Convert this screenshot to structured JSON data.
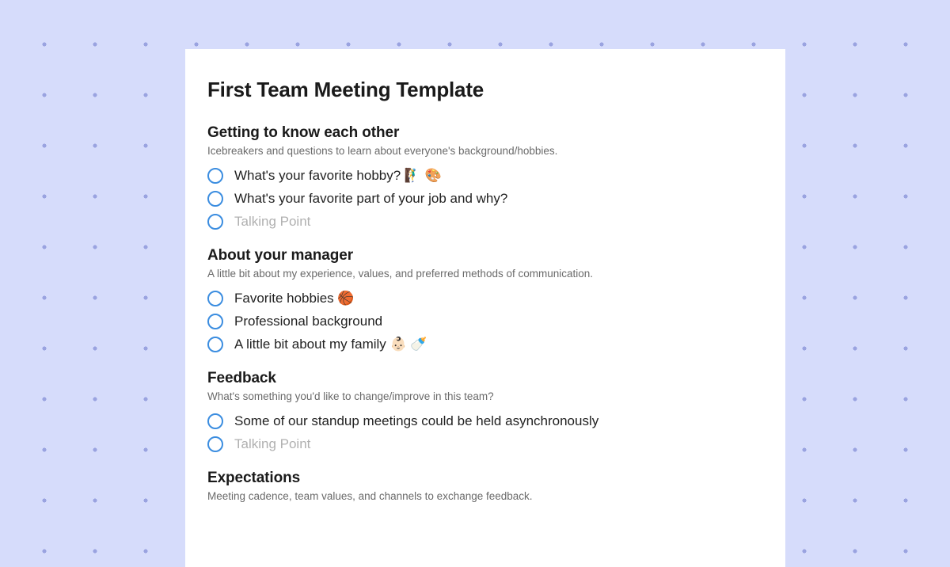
{
  "title": "First Team Meeting Template",
  "sections": [
    {
      "heading": "Getting to know each other",
      "subtitle": "Icebreakers and questions to learn about everyone's background/hobbies.",
      "items": [
        {
          "text": "What's your favorite hobby? 🧗‍♂️ 🎨",
          "placeholder": false
        },
        {
          "text": "What's your favorite part of your job and why?",
          "placeholder": false
        },
        {
          "text": "Talking Point",
          "placeholder": true
        }
      ]
    },
    {
      "heading": "About your manager",
      "subtitle": "A little bit about my experience, values, and preferred methods of communication.",
      "items": [
        {
          "text": "Favorite hobbies 🏀",
          "placeholder": false
        },
        {
          "text": "Professional background",
          "placeholder": false
        },
        {
          "text": "A little bit about my family 👶🏻 🍼",
          "placeholder": false
        }
      ]
    },
    {
      "heading": "Feedback",
      "subtitle": "What's something you'd like to change/improve in this team?",
      "items": [
        {
          "text": "Some of our standup meetings could be held asynchronously",
          "placeholder": false
        },
        {
          "text": "Talking Point",
          "placeholder": true
        }
      ]
    },
    {
      "heading": "Expectations",
      "subtitle": "Meeting cadence, team values, and channels to exchange feedback.",
      "items": []
    }
  ]
}
